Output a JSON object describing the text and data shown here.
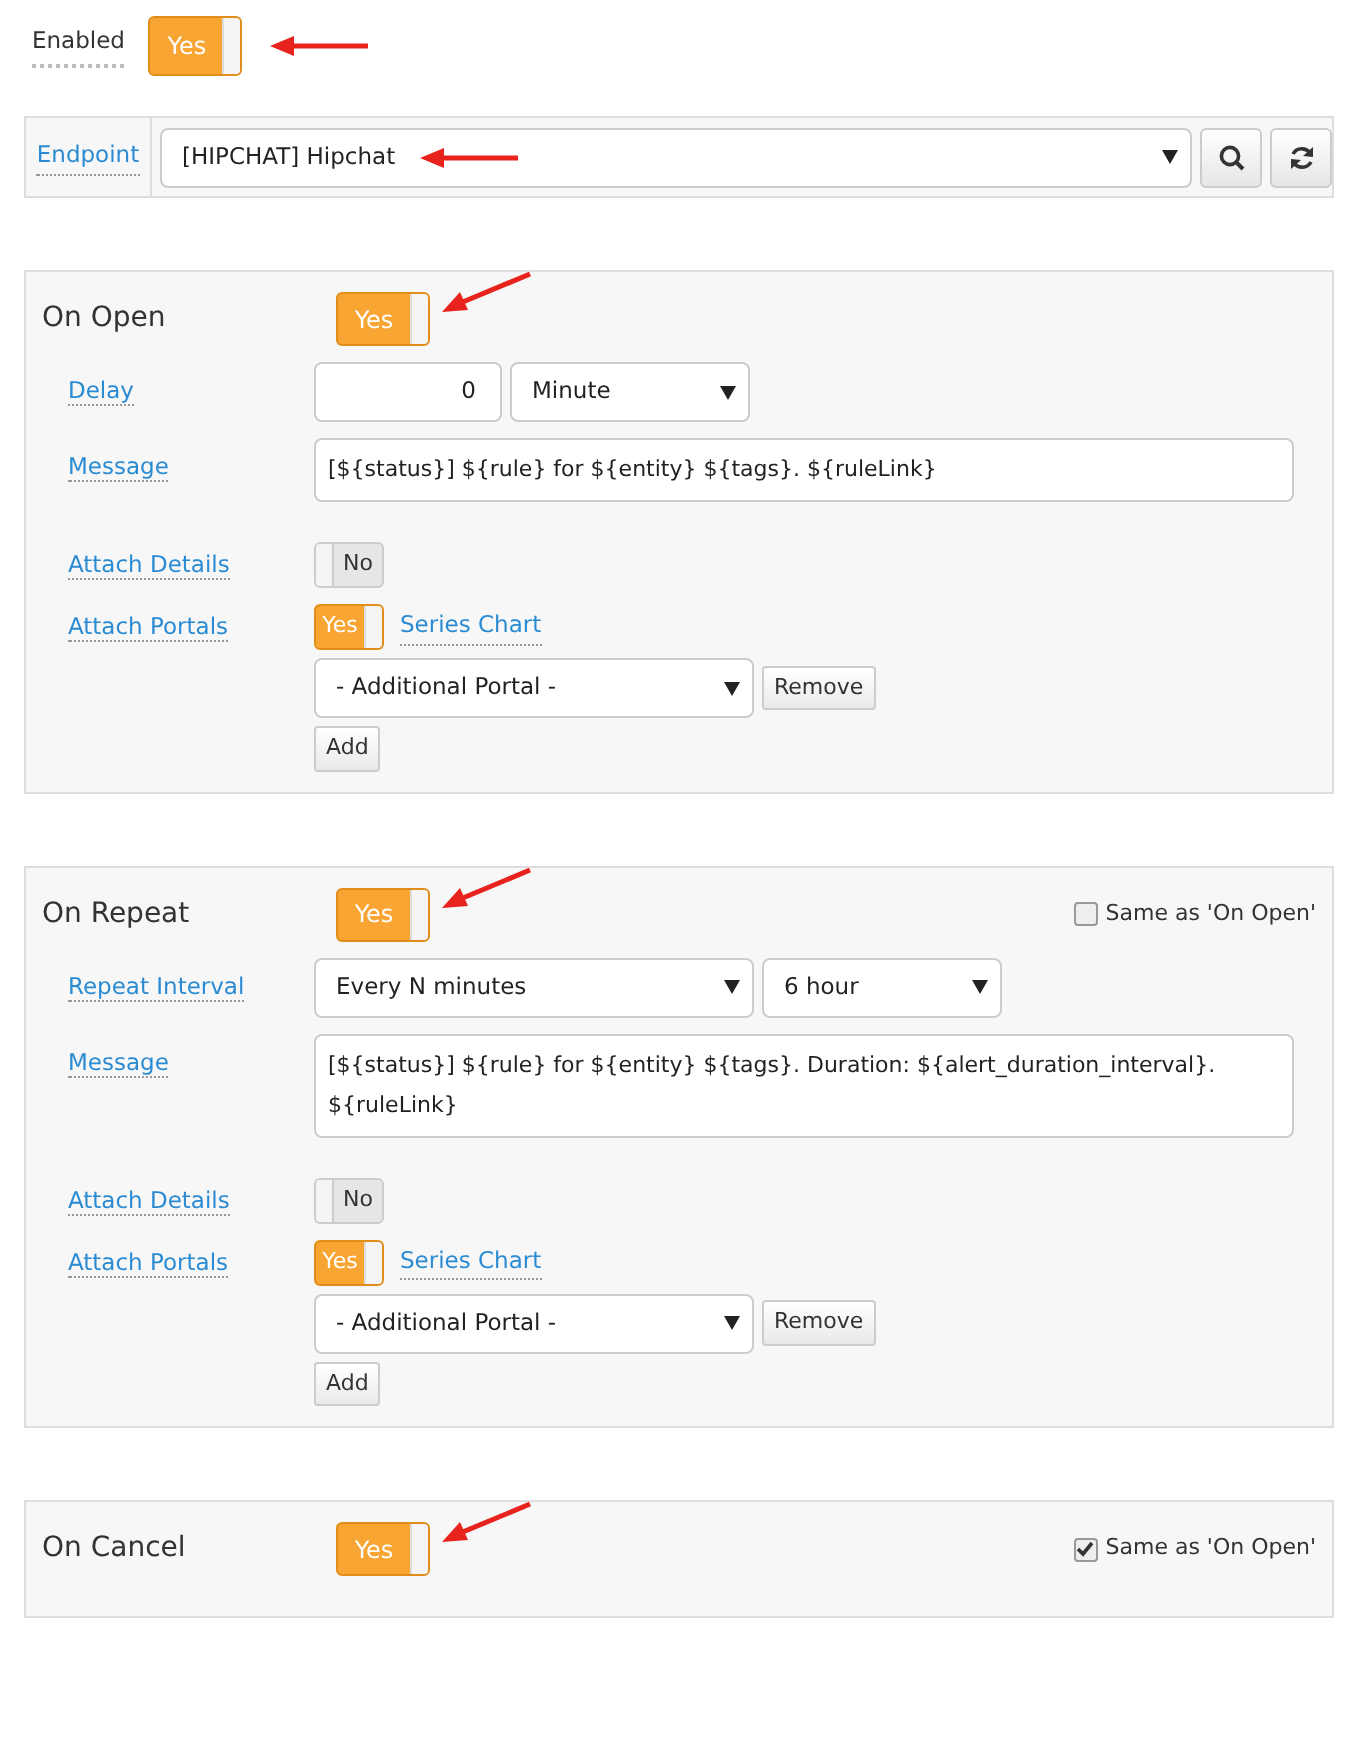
{
  "enabled": {
    "label": "Enabled",
    "on": true,
    "text": "Yes",
    "arrow": true
  },
  "endpoint": {
    "label": "Endpoint",
    "value": "[HIPCHAT] Hipchat",
    "arrow": true
  },
  "sections": [
    {
      "title": "On Open",
      "on": true,
      "text": "Yes",
      "arrow": true,
      "fields": [
        {
          "kind": "delay",
          "label": "Delay",
          "value": "0",
          "unit": "Minute"
        },
        {
          "kind": "message",
          "label": "Message",
          "value": "[${status}] ${rule} for ${entity} ${tags}. ${ruleLink}"
        },
        {
          "kind": "toggle",
          "label": "Attach Details",
          "on": false,
          "text": "No"
        },
        {
          "kind": "portals",
          "label": "Attach Portals",
          "on": true,
          "text": "Yes",
          "link": "Series Chart",
          "select": "- Additional Portal -",
          "remove": "Remove",
          "add": "Add"
        }
      ]
    },
    {
      "title": "On Repeat",
      "on": true,
      "text": "Yes",
      "arrow": true,
      "same": {
        "label": "Same as 'On Open'",
        "checked": false
      },
      "fields": [
        {
          "kind": "interval",
          "label": "Repeat Interval",
          "value": "Every N minutes",
          "unit": "6 hour"
        },
        {
          "kind": "message",
          "label": "Message",
          "value": "[${status}] ${rule} for ${entity} ${tags}. Duration: ${alert_duration_interval}. ${ruleLink}"
        },
        {
          "kind": "toggle",
          "label": "Attach Details",
          "on": false,
          "text": "No"
        },
        {
          "kind": "portals",
          "label": "Attach Portals",
          "on": true,
          "text": "Yes",
          "link": "Series Chart",
          "select": "- Additional Portal -",
          "remove": "Remove",
          "add": "Add"
        }
      ]
    },
    {
      "title": "On Cancel",
      "on": true,
      "text": "Yes",
      "arrow": true,
      "same": {
        "label": "Same as 'On Open'",
        "checked": true
      }
    }
  ]
}
